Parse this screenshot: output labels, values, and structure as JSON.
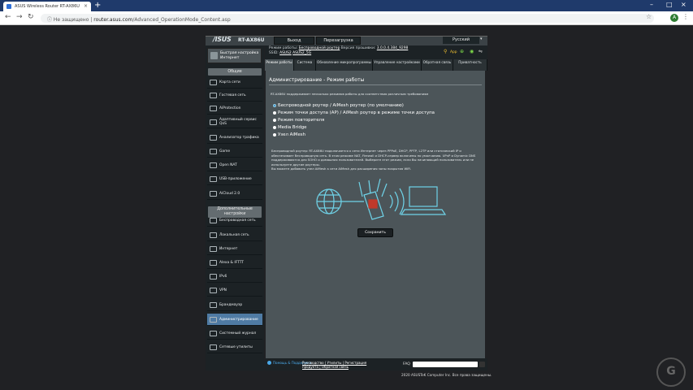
{
  "browser": {
    "tab_title": "ASUS Wireless Router RT-AX86U",
    "tab_close": "×",
    "new_tab": "+",
    "insecure_label": "Не защищено",
    "url_prefix": "router.asus.com",
    "url_path": "/Advanced_OperationMode_Content.asp",
    "avatar_letter": "A"
  },
  "header": {
    "logo": "/ISUS",
    "model": "RT-AX86U",
    "logout": "Выход",
    "reboot": "Перезагрузка",
    "language": "Русский"
  },
  "status": {
    "mode_label": "Режим работы:",
    "mode_value": "Беспроводной роутер",
    "firmware_label": "Версия прошивки:",
    "firmware_value": "3.0.0.4.384_9298",
    "ssid_label": "SSID:",
    "ssid_1": "ASUS2",
    "ssid_2": "ASUS2_5G",
    "app_label": "App"
  },
  "sidebar": {
    "quick_setup": "Быстрая настройка Интернет",
    "general_header": "Общие",
    "general_items": [
      "Карта сети",
      "Гостевая сеть",
      "AiProtection",
      "Адаптивный сервис QoS",
      "Анализатор трафика",
      "Game",
      "Open NAT",
      "USB-приложение",
      "AiCloud 2.0"
    ],
    "advanced_header": "Дополнительные настройки",
    "advanced_items": [
      "Беспроводная сеть",
      "Локальная сеть",
      "Интернет",
      "Alexa & IFTTT",
      "IPv6",
      "VPN",
      "Брандмауэр",
      "Администрирование",
      "Системный журнал",
      "Сетевые утилиты"
    ]
  },
  "tabs": [
    "Режим работы",
    "Система",
    "Обновление микропрограммы",
    "Управление настройками",
    "Обратная связь",
    "Приватность"
  ],
  "content": {
    "title": "Администрирование - Режим работы",
    "subtitle": "RT-AX86U поддерживает несколько режимов работы для соответствия различным требованиям",
    "options": [
      "Беспроводной роутер / AiMesh роутер (по умолчанию)",
      "Режим точки доступа (AP) / AiMesh роутер в режиме точки доступа",
      "Режим повторителя",
      "Media Bridge",
      "Узел AiMesh"
    ],
    "description_1": "Беспроводной роутер: RT-AX86U подключается к сети Интернет через PPPoE, DHCP, PPTP, L2TP или статический IP и обеспечивает беспроводную сеть. В этом режиме NAT, Firewall и DHCP-сервер включены по умолчанию. UPnP и Dynamic DNS поддерживаются для SOHO и домашних пользователей. Выберите этот режим, если Вы начинающий пользователь или не используете другие роутеры.",
    "description_2": "Вы можете добавить узел AiMesh к сети AiMesh для расширения зоны покрытия WiFi.",
    "save": "Сохранить"
  },
  "footer": {
    "help": "Помощь & Поддержка",
    "links_1": "Руководство | Утилиты | Регистрация",
    "links_2": "продукта | Обратная связь",
    "faq": "FAQ",
    "copyright": "2020 ASUSTeK Computer Inc. Все права защищены."
  },
  "colors": {
    "accent": "#4f7ba4",
    "panel": "#4c5559",
    "dark": "#1c2225",
    "selected_radio": "#2f8bd3"
  }
}
